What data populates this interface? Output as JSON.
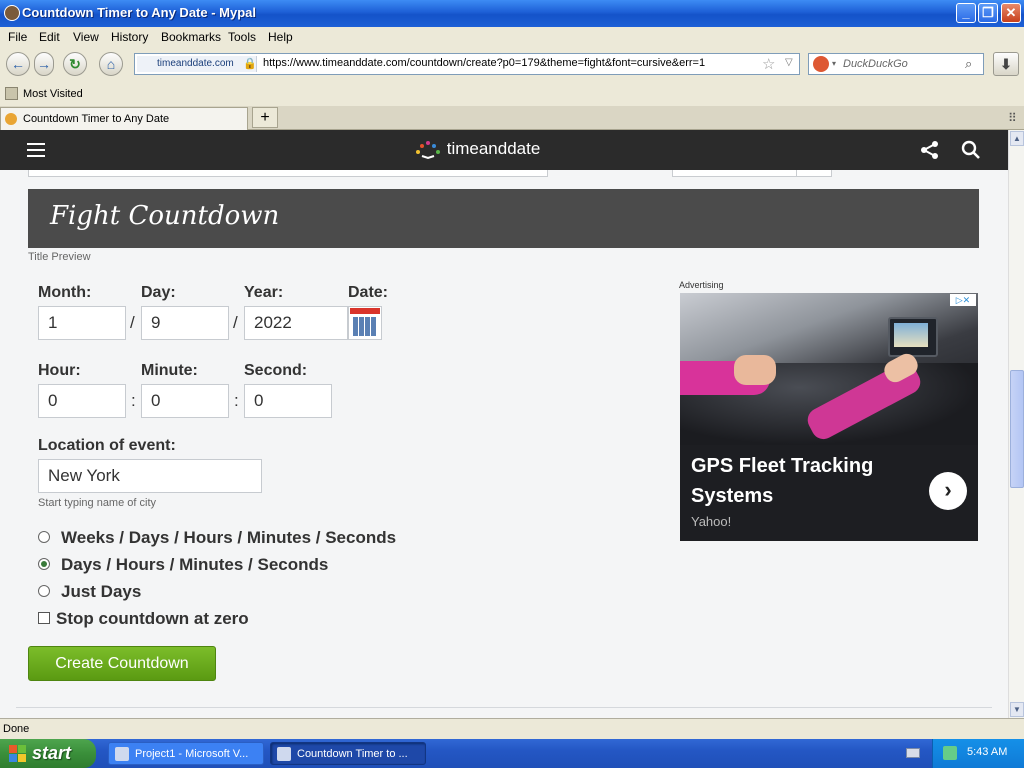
{
  "window": {
    "title": "Countdown Timer to Any Date - Mypal",
    "controls": {
      "minimize": "_",
      "maximize": "❐",
      "close": "✕"
    }
  },
  "menu": [
    "File",
    "Edit",
    "View",
    "History",
    "Bookmarks",
    "Tools",
    "Help"
  ],
  "navbar": {
    "site_identity": "timeanddate.com",
    "url": "https://www.timeanddate.com/countdown/create?p0=179&theme=fight&font=cursive&err=1",
    "search_placeholder": "DuckDuckGo"
  },
  "bookmarks": {
    "most_visited": "Most Visited"
  },
  "tabs": [
    {
      "label": "Countdown Timer to Any Date"
    }
  ],
  "site": {
    "logo_text": "timeanddate",
    "title_preview": "Fight Countdown",
    "title_preview_label": "Title Preview"
  },
  "form": {
    "month_label": "Month:",
    "month_value": "1",
    "day_label": "Day:",
    "day_value": "9",
    "year_label": "Year:",
    "year_value": "2022",
    "date_label": "Date:",
    "date_sep": "/",
    "hour_label": "Hour:",
    "hour_value": "0",
    "minute_label": "Minute:",
    "minute_value": "0",
    "second_label": "Second:",
    "second_value": "0",
    "time_sep": ":",
    "location_label": "Location of event:",
    "location_value": "New York",
    "location_hint": "Start typing name of city",
    "display_options": [
      {
        "label": "Weeks / Days / Hours / Minutes / Seconds",
        "selected": false
      },
      {
        "label": "Days / Hours / Minutes / Seconds",
        "selected": true
      },
      {
        "label": "Just Days",
        "selected": false
      }
    ],
    "stop_at_zero_label": "Stop countdown at zero",
    "stop_at_zero_checked": false,
    "submit_label": "Create Countdown"
  },
  "ad": {
    "label": "Advertising",
    "title": "GPS Fleet Tracking Systems",
    "source": "Yahoo!"
  },
  "status": {
    "text": "Done"
  },
  "taskbar": {
    "start_label": "start",
    "tasks": [
      {
        "label": "Project1 - Microsoft V...",
        "active": false
      },
      {
        "label": "Countdown Timer to ...",
        "active": true
      }
    ],
    "clock": "5:43 AM"
  },
  "colors": {
    "titlebar": "#1d5fd6",
    "site_header": "#2b2b2b",
    "title_preview_bg": "#4b4b4b",
    "create_button": "#6aab1e",
    "taskbar": "#2457c4"
  }
}
